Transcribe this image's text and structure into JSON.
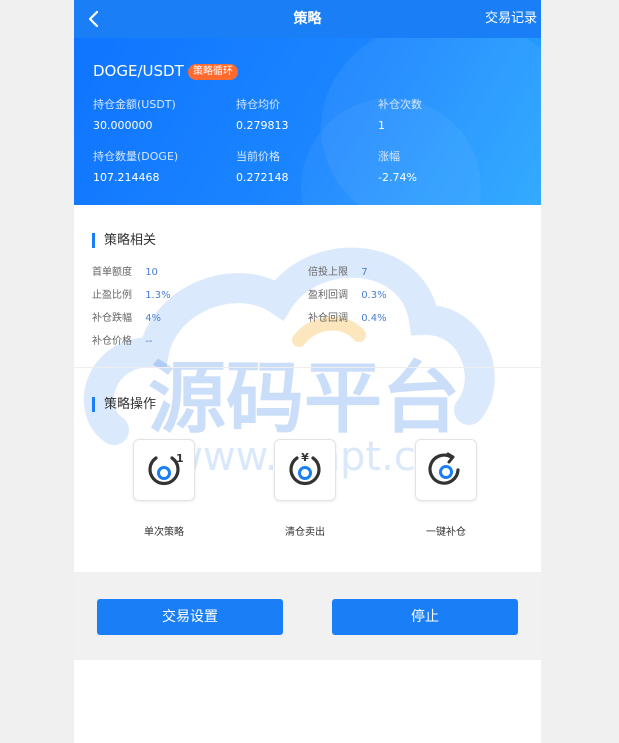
{
  "header": {
    "title": "策略",
    "right_link": "交易记录"
  },
  "summary": {
    "pair": "DOGE/USDT",
    "badge": "策略循环",
    "stats": [
      {
        "label": "持仓金额(USDT)",
        "value": "30.000000"
      },
      {
        "label": "持仓均价",
        "value": "0.279813"
      },
      {
        "label": "补仓次数",
        "value": "1"
      },
      {
        "label": "持仓数量(DOGE)",
        "value": "107.214468"
      },
      {
        "label": "当前价格",
        "value": "0.272148"
      },
      {
        "label": "涨幅",
        "value": "-2.74%"
      }
    ]
  },
  "strategy": {
    "title": "策略相关",
    "items": [
      {
        "label": "首单额度",
        "value": "10"
      },
      {
        "label": "倍投上限",
        "value": "7"
      },
      {
        "label": "止盈比例",
        "value": "1.3%"
      },
      {
        "label": "盈利回调",
        "value": "0.3%"
      },
      {
        "label": "补仓跌幅",
        "value": "4%"
      },
      {
        "label": "补仓回调",
        "value": "0.4%"
      },
      {
        "label": "补仓价格",
        "value": "--"
      }
    ]
  },
  "operations": {
    "title": "策略操作",
    "items": [
      {
        "label": "单次策略",
        "icon": "single-cycle-icon",
        "glyph": "1"
      },
      {
        "label": "清仓卖出",
        "icon": "sell-all-icon",
        "glyph": "¥"
      },
      {
        "label": "一键补仓",
        "icon": "one-click-cover-icon",
        "glyph": ""
      }
    ]
  },
  "actions": {
    "settings": "交易设置",
    "stop": "停止"
  },
  "watermark": {
    "title": "源码平台",
    "url": "www.ympt.cc"
  },
  "colors": {
    "primary": "#1a7ff6",
    "badge": "#ff6a2f",
    "value_text": "#4a7fd6"
  }
}
